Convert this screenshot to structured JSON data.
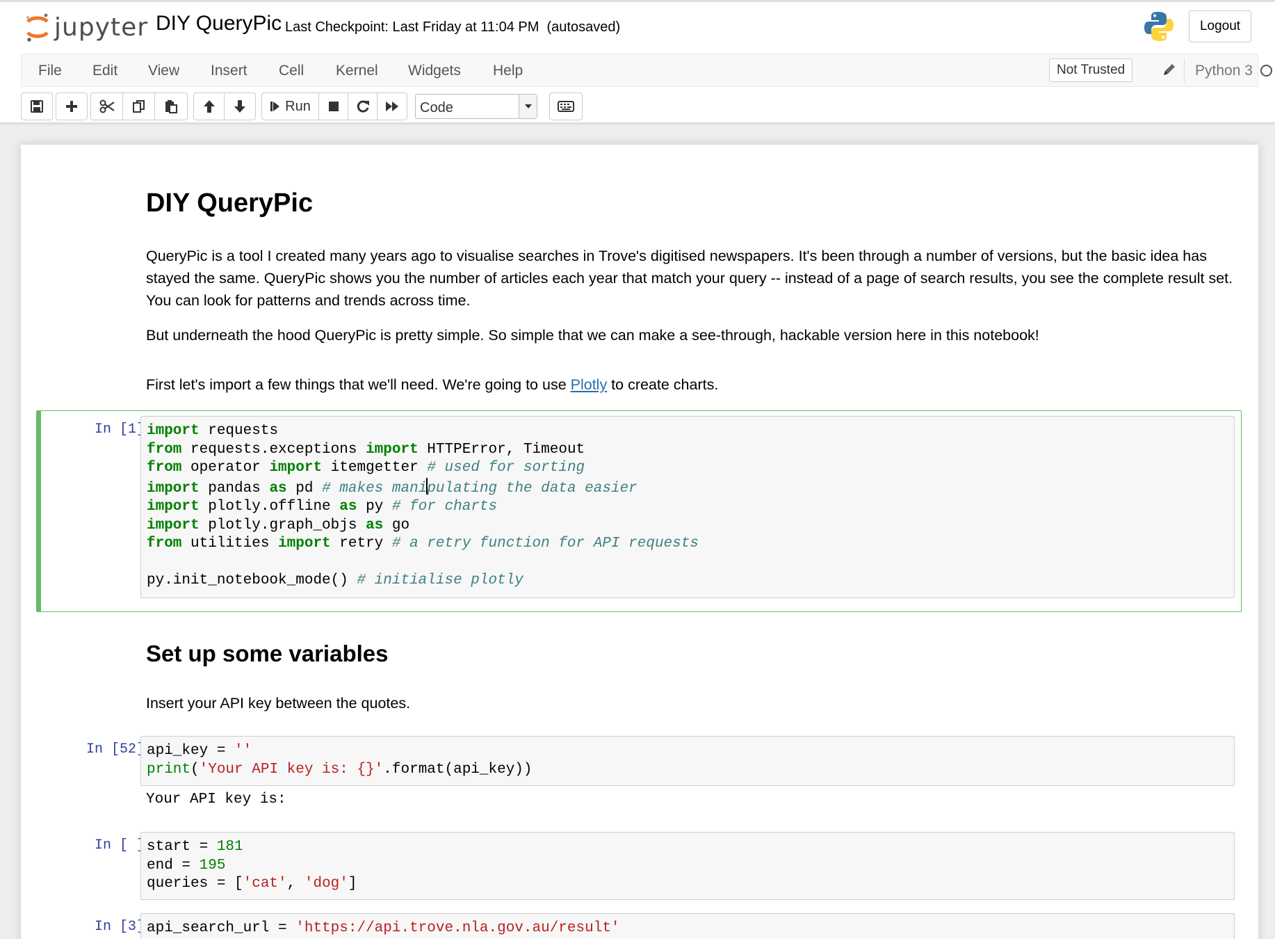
{
  "header": {
    "logo_text": "jupyter",
    "notebook_name": "DIY QueryPic",
    "checkpoint": "Last Checkpoint: Last Friday at 11:04 PM  (autosaved)",
    "logout_label": "Logout"
  },
  "menubar": {
    "items": [
      "File",
      "Edit",
      "View",
      "Insert",
      "Cell",
      "Kernel",
      "Widgets",
      "Help"
    ],
    "not_trusted": "Not Trusted",
    "kernel_name": "Python 3"
  },
  "toolbar": {
    "run_label": "Run",
    "cell_type": "Code"
  },
  "cells": {
    "title": "DIY QueryPic",
    "intro": "QueryPic is a tool I created many years ago to visualise searches in Trove's digitised newspapers. It's been through a number of versions, but the basic idea has stayed the same. QueryPic shows you the number of articles each year that match your query -- instead of a page of search results, you see the complete result set. You can look for patterns and trends across time.",
    "hood": "But underneath the hood QueryPic is pretty simple. So simple that we can make a see-through, hackable version here in this notebook!",
    "import_before": "First let's import a few things that we'll need. We're going to use ",
    "import_link": "Plotly",
    "import_after": " to create charts.",
    "setup_heading": "Set up some variables",
    "api_instructions": "Insert your API key between the quotes.",
    "prompt_1": "In [1]:",
    "prompt_2": "In [52]:",
    "prompt_3": "In [ ]:",
    "prompt_4": "In [3]:",
    "output_2": "Your API key is:"
  },
  "code": {
    "c1": [
      [
        "kw:import",
        "t: requests"
      ],
      [
        "kw:from",
        "t: requests.exceptions ",
        "kw:import",
        "t: HTTPError, Timeout"
      ],
      [
        "kw:from",
        "t: operator ",
        "kw:import",
        "t: itemgetter ",
        "cm:# used for sorting"
      ],
      [
        "kw:import",
        "t: pandas ",
        "kw:as",
        "t: pd ",
        "cm:# makes mani",
        "cur:",
        "cm:pulating the data easier"
      ],
      [
        "kw:import",
        "t: plotly.offline ",
        "kw:as",
        "t: py ",
        "cm:# for charts"
      ],
      [
        "kw:import",
        "t: plotly.graph_objs ",
        "kw:as",
        "t: go"
      ],
      [
        "kw:from",
        "t: utilities ",
        "kw:import",
        "t: retry ",
        "cm:# a retry function for API requests"
      ],
      [],
      [
        "t:py.init_notebook_mode() ",
        "cm:# initialise plotly"
      ]
    ],
    "c2": [
      [
        "t:api_key = ",
        "st:''"
      ],
      [
        "bi:print",
        "t:(",
        "st:'Your API key is: {}'",
        "t:.format(api_key))"
      ]
    ],
    "c3": [
      [
        "t:start = ",
        "nu:181"
      ],
      [
        "t:end = ",
        "nu:195"
      ],
      [
        "t:queries = [",
        "st:'cat'",
        "t:, ",
        "st:'dog'",
        "t:]"
      ]
    ],
    "c4": [
      [
        "t:api_search_url = ",
        "st:'https://api.trove.nla.gov.au/result'"
      ]
    ]
  }
}
